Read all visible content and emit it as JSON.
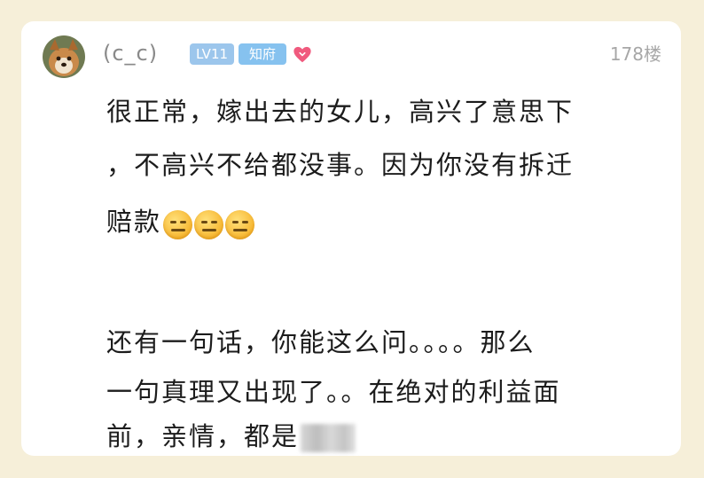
{
  "comment": {
    "username": "(c_c)",
    "level_badge": "LV11",
    "title_badge": "知府",
    "floor": "178楼",
    "icons": {
      "avatar": "dog-avatar",
      "heart": "heart-icon",
      "emoji": "expressionless-face-emoji"
    },
    "lines": [
      "很正常，嫁出去的女儿，高兴了意思下",
      "，不高兴不给都没事。因为你没有拆迁",
      "赔款",
      "还有一句话，你能这么问。。。。那么",
      "一句真理又出现了。。在绝对的利益面",
      "前，亲情，都是"
    ]
  },
  "colors": {
    "page_background": "#f6efd9",
    "card_background": "#ffffff",
    "level_badge": "#9cc6ec",
    "title_badge": "#86c2ef",
    "heart": "#f05a7e",
    "username": "#8a8a8a"
  }
}
